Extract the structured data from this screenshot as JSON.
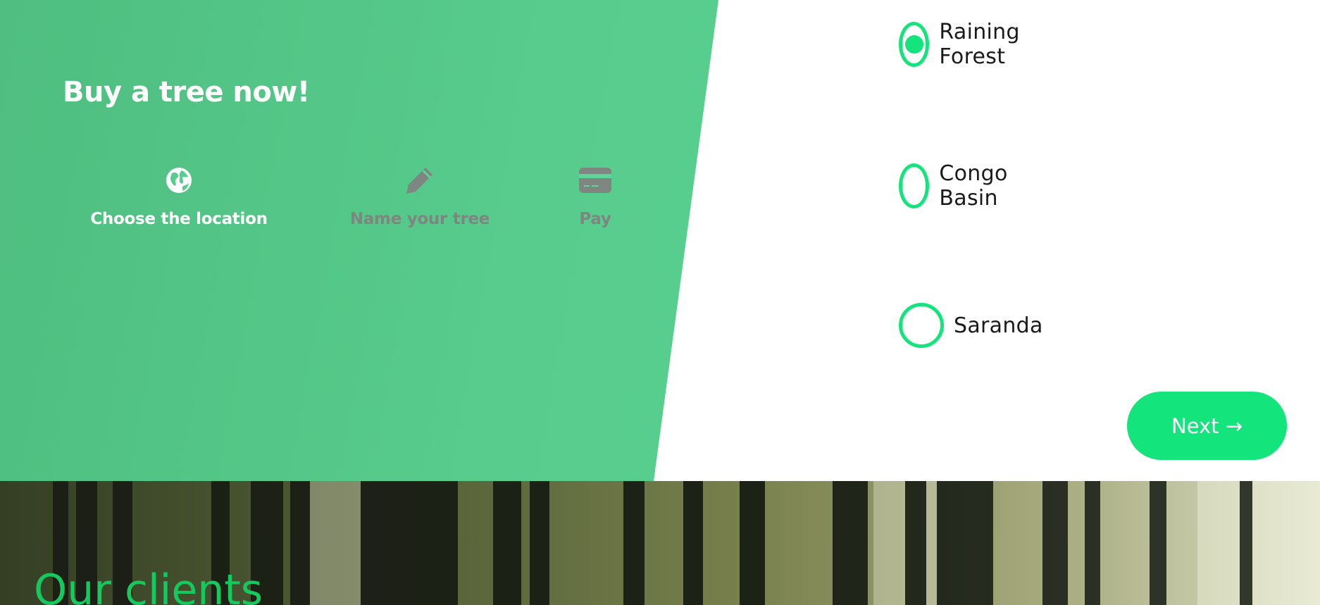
{
  "hero": {
    "title": "Buy a tree now!",
    "steps": [
      {
        "label": "Choose the location",
        "icon": "globe-icon",
        "active": true
      },
      {
        "label": "Name your tree",
        "icon": "pencil-icon",
        "active": false
      },
      {
        "label": "Pay",
        "icon": "credit-card-icon",
        "active": false
      }
    ]
  },
  "locations": {
    "options": [
      {
        "label": "Raining Forest",
        "selected": true
      },
      {
        "label": "Congo Basin",
        "selected": false
      },
      {
        "label": "Saranda",
        "selected": false
      }
    ]
  },
  "actions": {
    "next_label": "Next →"
  },
  "clients": {
    "title": "Our clients"
  },
  "colors": {
    "accent": "#13e57c",
    "hero_green": "#57cc8c",
    "inactive_step": "#7f8581",
    "clients_title": "#14c95e"
  }
}
